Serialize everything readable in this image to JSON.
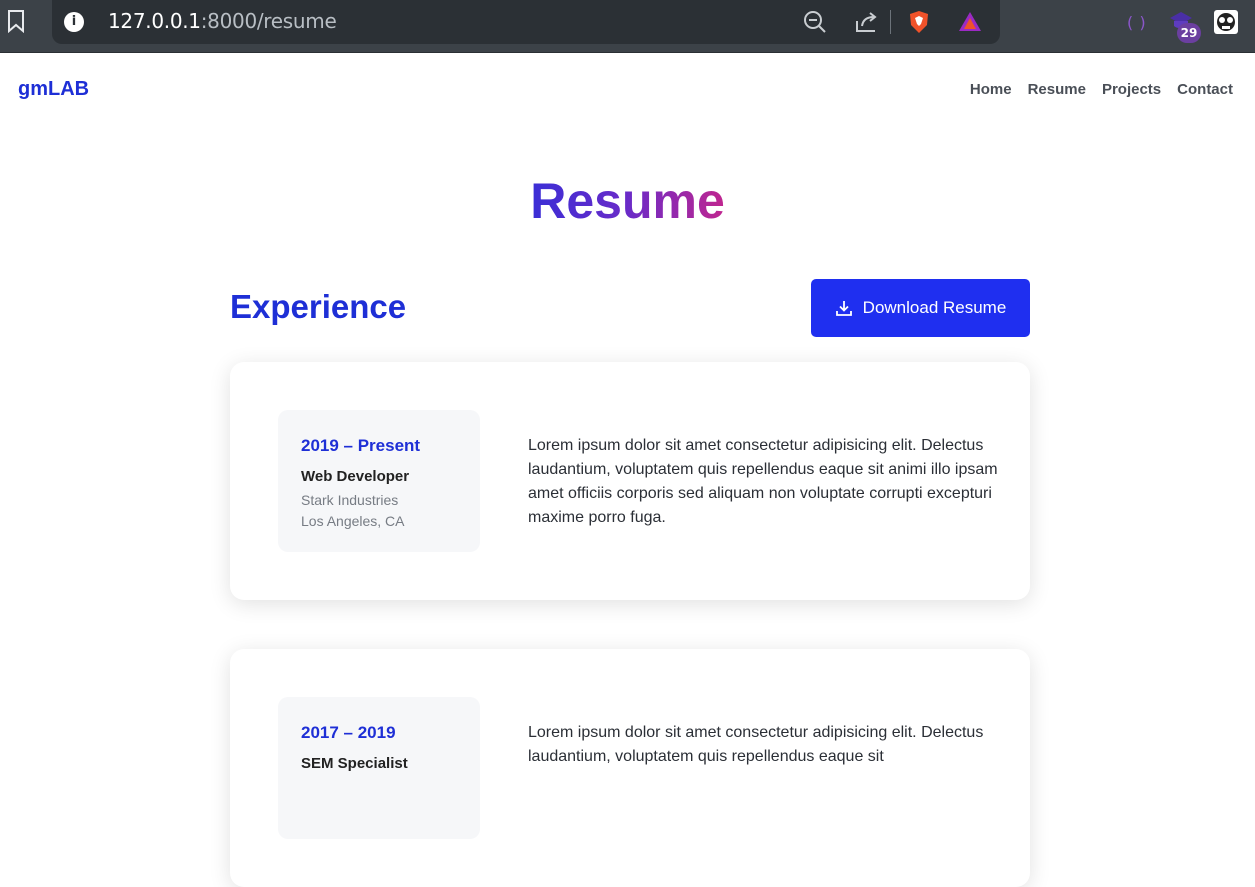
{
  "browser": {
    "url_host": "127.0.0.1",
    "url_rest": ":8000/resume",
    "extension_badge": "29"
  },
  "site": {
    "brand": "gmLAB",
    "nav": [
      "Home",
      "Resume",
      "Projects",
      "Contact"
    ]
  },
  "page": {
    "title": "Resume",
    "section_title": "Experience",
    "download_label": "Download Resume"
  },
  "experience": [
    {
      "period": "2019 – Present",
      "role": "Web Developer",
      "company": "Stark Industries",
      "location": "Los Angeles, CA",
      "description": "Lorem ipsum dolor sit amet consectetur adipisicing elit. Delectus laudantium, voluptatem quis repellendus eaque sit animi illo ipsam amet officiis corporis sed aliquam non voluptate corrupti excepturi maxime porro fuga."
    },
    {
      "period": "2017 – 2019",
      "role": "SEM Specialist",
      "description": "Lorem ipsum dolor sit amet consectetur adipisicing elit. Delectus laudantium, voluptatem quis repellendus eaque sit"
    }
  ],
  "colors": {
    "brand": "#1e2fd6",
    "button": "#1f2ff0",
    "title_gradient_start": "#3a2ed6",
    "title_gradient_end": "#c0268f"
  }
}
